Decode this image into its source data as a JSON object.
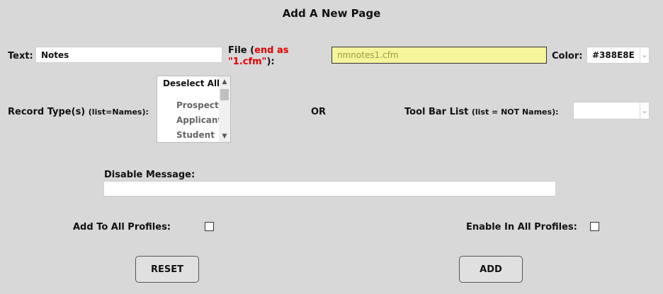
{
  "page": {
    "title": "Add A New Page"
  },
  "text_field": {
    "label": "Text:",
    "value": "Notes"
  },
  "file_field": {
    "label_prefix": "File (",
    "label_note_line1": "end as",
    "label_note_line2": "\"1.cfm\"",
    "label_suffix": "):",
    "value": "nmnotes1.cfm"
  },
  "color_field": {
    "label": "Color:",
    "value": "#388E8E"
  },
  "record_types": {
    "label": "Record Type(s)",
    "label_note": "(list=Names):",
    "options": [
      "Deselect All",
      "Prospect",
      "Applicant",
      "Student"
    ]
  },
  "or_text": "OR",
  "toolbar_list": {
    "label": "Tool Bar List",
    "label_note": "(list = NOT Names):",
    "value": ""
  },
  "disable_message": {
    "label": "Disable Message:",
    "value": ""
  },
  "add_to_all_profiles": {
    "label": "Add To All Profiles:",
    "checked": false
  },
  "enable_in_all_profiles": {
    "label": "Enable In All Profiles:",
    "checked": false
  },
  "buttons": {
    "reset": "RESET",
    "add": "ADD"
  }
}
